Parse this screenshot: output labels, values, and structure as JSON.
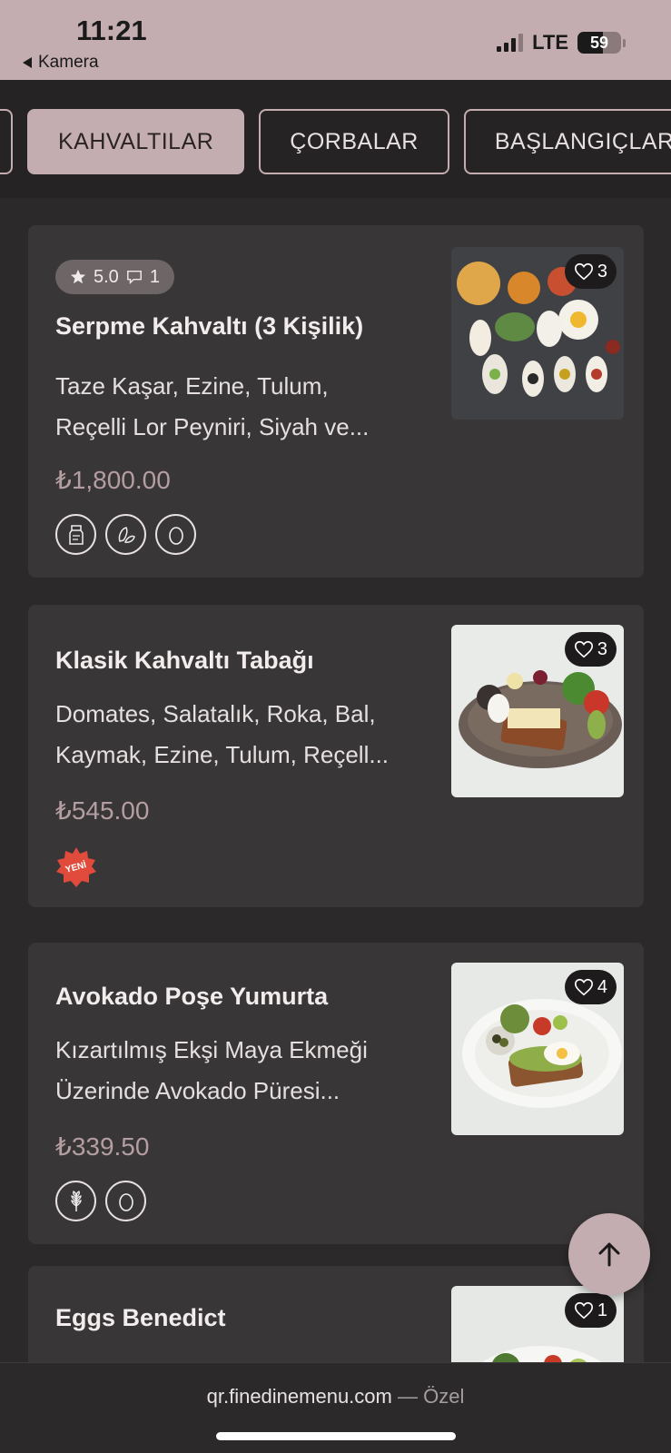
{
  "status": {
    "time": "11:21",
    "back_label": "Kamera",
    "network": "LTE",
    "battery": "59"
  },
  "categories": [
    "",
    "KAHVALTILAR",
    "ÇORBALAR",
    "BAŞLANGIÇLAR"
  ],
  "items": [
    {
      "rating": "5.0",
      "comments": "1",
      "title": "Serpme Kahvaltı (3 Kişilik)",
      "desc_line1": "Taze Kaşar, Ezine, Tulum,",
      "desc_line2": " Reçelli Lor Peyniri, Siyah ve...",
      "price": "₺1,800.00",
      "likes": "3",
      "icons": [
        "milk-icon",
        "nuts-icon",
        "egg-icon"
      ]
    },
    {
      "title": "Klasik Kahvaltı Tabağı",
      "desc_line1": "Domates, Salatalık, Roka, Bal,",
      "desc_line2": "Kaymak, Ezine, Tulum, Reçell...",
      "price": "₺545.00",
      "likes": "3",
      "badge": "YENİ"
    },
    {
      "title": "Avokado Poşe Yumurta",
      "desc_line1": "Kızartılmış Ekşi Maya Ekmeği",
      "desc_line2": "Üzerinde Avokado Püresi...",
      "price": "₺339.50",
      "likes": "4",
      "icons": [
        "wheat-icon",
        "egg-icon"
      ]
    },
    {
      "title": "Eggs Benedict",
      "likes": "1"
    }
  ],
  "footer": {
    "url": "qr.finedinemenu.com",
    "separator": "—",
    "mode": "Özel"
  },
  "colors": {
    "accent": "#c4adb0",
    "card": "#383637",
    "background": "#2b292a",
    "price": "#b59ea2",
    "new_badge": "#e04b3c"
  }
}
